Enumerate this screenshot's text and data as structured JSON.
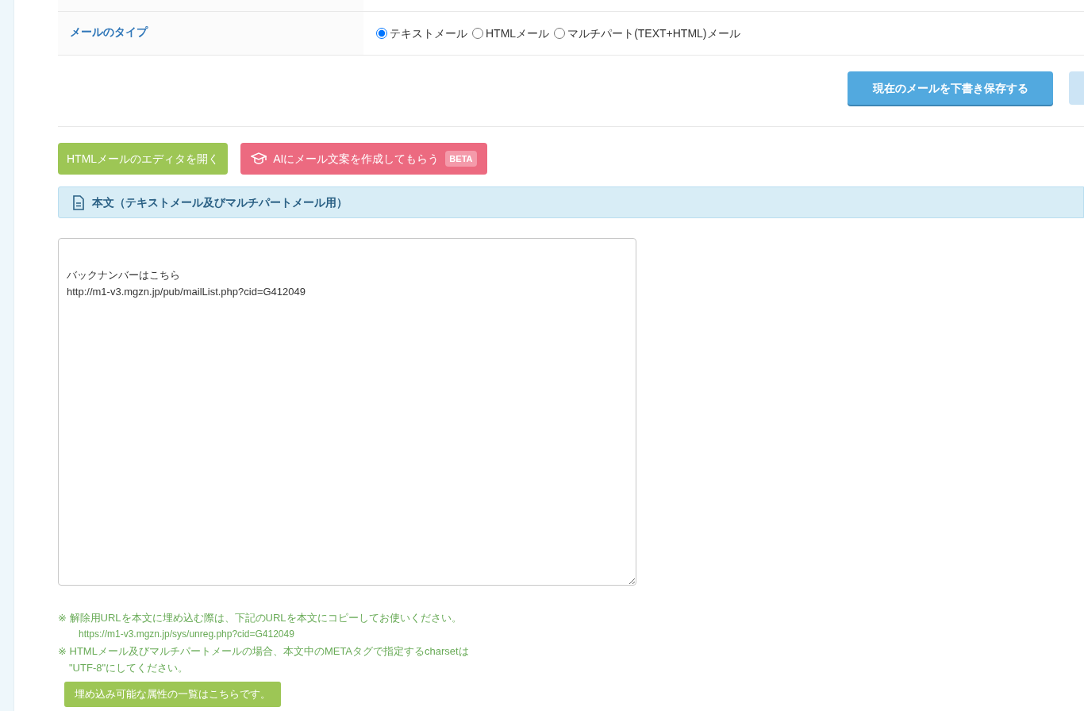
{
  "mail_type": {
    "label": "メールのタイプ",
    "options": [
      {
        "label": "テキストメール",
        "selected": true
      },
      {
        "label": "HTMLメール",
        "selected": false
      },
      {
        "label": "マルチパート(TEXT+HTML)メール",
        "selected": false
      }
    ]
  },
  "save_draft_button": "現在のメールを下書き保存する",
  "html_editor_button": "HTMLメールのエディタを開く",
  "ai_button": {
    "label": "AIにメール文案を作成してもらう",
    "badge": "BETA"
  },
  "body_section": {
    "title": "本文（テキストメール及びマルチパートメール用）",
    "value": "\nバックナンバーはこちら\nhttp://m1-v3.mgzn.jp/pub/mailList.php?cid=G412049"
  },
  "notes": [
    {
      "kind": "note",
      "text": "※ 解除用URLを本文に埋め込む際は、下記のURLを本文にコピーしてお使いください。"
    },
    {
      "kind": "url",
      "text": "https://m1-v3.mgzn.jp/sys/unreg.php?cid=G412049"
    },
    {
      "kind": "note",
      "text": "※ HTMLメール及びマルチパートメールの場合、本文中のMETAタグで指定するcharsetは"
    },
    {
      "kind": "cont",
      "text": "\"UTF-8\"にしてください。"
    }
  ],
  "attributes_button": "埋め込み可能な属性の一覧はこちらです。"
}
